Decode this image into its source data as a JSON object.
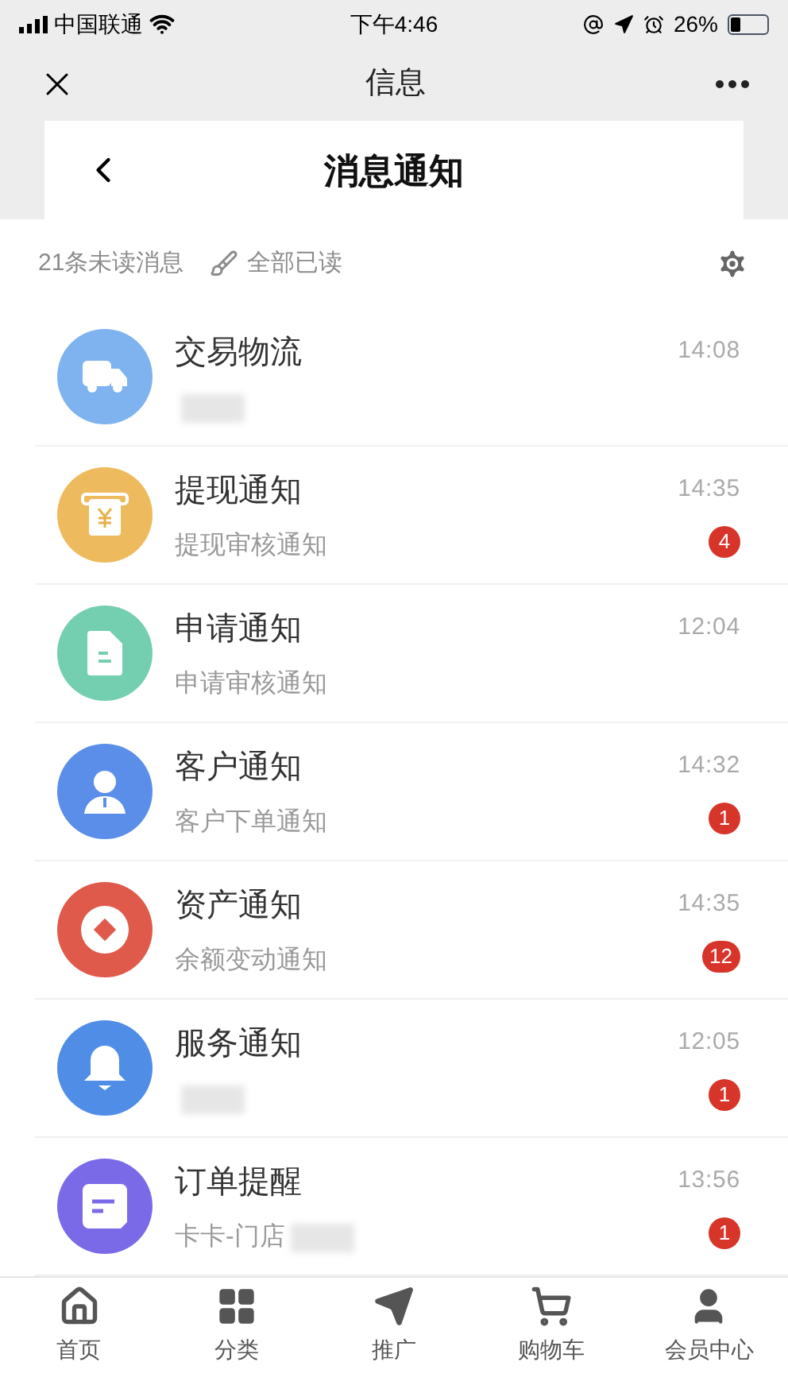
{
  "status_bar": {
    "carrier": "中国联通",
    "time": "下午4:46",
    "battery": "26%"
  },
  "header": {
    "title": "信息"
  },
  "subheader": {
    "title": "消息通知"
  },
  "summary": {
    "unread": "21条未读消息",
    "mark_all": "全部已读"
  },
  "messages": [
    {
      "kind": "truck",
      "color": "#7fb3f0",
      "title": "交易物流",
      "time": "14:08",
      "redacted": true
    },
    {
      "kind": "yuan",
      "color": "#edbb5e",
      "title": "提现通知",
      "subtitle": "提现审核通知",
      "time": "14:35",
      "badge": "4"
    },
    {
      "kind": "document",
      "color": "#74ceb0",
      "title": "申请通知",
      "subtitle": "申请审核通知",
      "time": "12:04"
    },
    {
      "kind": "person",
      "color": "#5b8ee8",
      "title": "客户通知",
      "subtitle": "客户下单通知",
      "time": "14:32",
      "badge": "1"
    },
    {
      "kind": "coin",
      "color": "#df5a4a",
      "title": "资产通知",
      "subtitle": "余额变动通知",
      "time": "14:35",
      "badge": "12"
    },
    {
      "kind": "bell",
      "color": "#4f8de6",
      "title": "服务通知",
      "time": "12:05",
      "badge": "1",
      "redacted": true
    },
    {
      "kind": "note",
      "color": "#7b6ae8",
      "title": "订单提醒",
      "subtitle": "卡卡-门店",
      "time": "13:56",
      "badge": "1",
      "redacted": true
    }
  ],
  "tabs": [
    {
      "kind": "home",
      "label": "首页",
      "selected": false
    },
    {
      "kind": "grid",
      "label": "分类",
      "selected": false
    },
    {
      "kind": "send",
      "label": "推广",
      "selected": false
    },
    {
      "kind": "cart",
      "label": "购物车",
      "selected": false
    },
    {
      "kind": "user",
      "label": "会员中心",
      "selected": false
    }
  ]
}
